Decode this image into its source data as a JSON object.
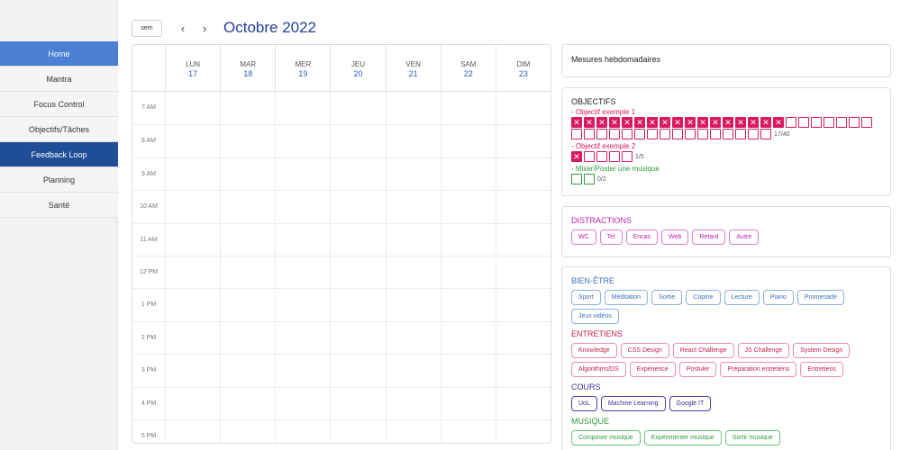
{
  "sidebar": {
    "items": [
      {
        "label": "Home",
        "state": "active"
      },
      {
        "label": "Mantra",
        "state": ""
      },
      {
        "label": "Focus Control",
        "state": ""
      },
      {
        "label": "Objectifs/Tâches",
        "state": ""
      },
      {
        "label": "Feedback Loop",
        "state": "selected"
      },
      {
        "label": "Planning",
        "state": ""
      },
      {
        "label": "Santé",
        "state": ""
      }
    ]
  },
  "header": {
    "view_button": "sem",
    "prev_icon": "chevron-left-icon",
    "next_icon": "chevron-right-icon",
    "title": "Octobre 2022"
  },
  "calendar": {
    "days": [
      {
        "name": "LUN",
        "num": "17"
      },
      {
        "name": "MAR",
        "num": "18"
      },
      {
        "name": "MER",
        "num": "19"
      },
      {
        "name": "JEU",
        "num": "20"
      },
      {
        "name": "VEN",
        "num": "21"
      },
      {
        "name": "SAM",
        "num": "22"
      },
      {
        "name": "DIM",
        "num": "23"
      }
    ],
    "hours": [
      "7 AM",
      "8 AM",
      "9 AM",
      "10 AM",
      "11 AM",
      "12 PM",
      "1 PM",
      "2 PM",
      "3 PM",
      "4 PM",
      "5 PM"
    ]
  },
  "weekly": {
    "title": "Mesures hebdomadaires"
  },
  "objectifs": {
    "title": "OBJECTIFS",
    "items": [
      {
        "label": "- Objectif exemple 1",
        "color": "pink",
        "done": 17,
        "total": 40,
        "count": "17/40"
      },
      {
        "label": "- Objectif exemple 2",
        "color": "pink",
        "done": 1,
        "total": 5,
        "count": "1/5"
      },
      {
        "label": "- Mixer/Poster une musique",
        "color": "green",
        "done": 0,
        "total": 2,
        "count": "0/2"
      }
    ],
    "colors": {
      "pink": "#d81b60",
      "green": "#2e9a3c"
    }
  },
  "distractions": {
    "title": "DISTRACTIONS",
    "tags": [
      "WC",
      "Tel",
      "Encas",
      "Web",
      "Retard",
      "Autre"
    ]
  },
  "categories": [
    {
      "title": "BIEN-ÊTRE",
      "color": "blue",
      "title_color": "#3d6fb8",
      "tags": [
        "Sport",
        "Méditation",
        "Sortie",
        "Copine",
        "Lecture",
        "Piano",
        "Promenade",
        "Jeux vidéos"
      ]
    },
    {
      "title": "ENTRETIENS",
      "color": "red",
      "title_color": "#c8204a",
      "tags": [
        "Knowledge",
        "CSS Design",
        "React Challenge",
        "JS Challenge",
        "System Design",
        "Algorithms/DS",
        "Expérience",
        "Postuler",
        "Préparation entretiens",
        "Entretiens"
      ]
    },
    {
      "title": "COURS",
      "color": "purple",
      "title_color": "#3a2e98",
      "tags": [
        "UoL",
        "Machine Learning",
        "Google IT"
      ]
    },
    {
      "title": "MUSIQUE",
      "color": "green",
      "title_color": "#2e9a3c",
      "tags": [
        "Composer musique",
        "Expérimenter musique",
        "Sortir musique"
      ]
    }
  ]
}
